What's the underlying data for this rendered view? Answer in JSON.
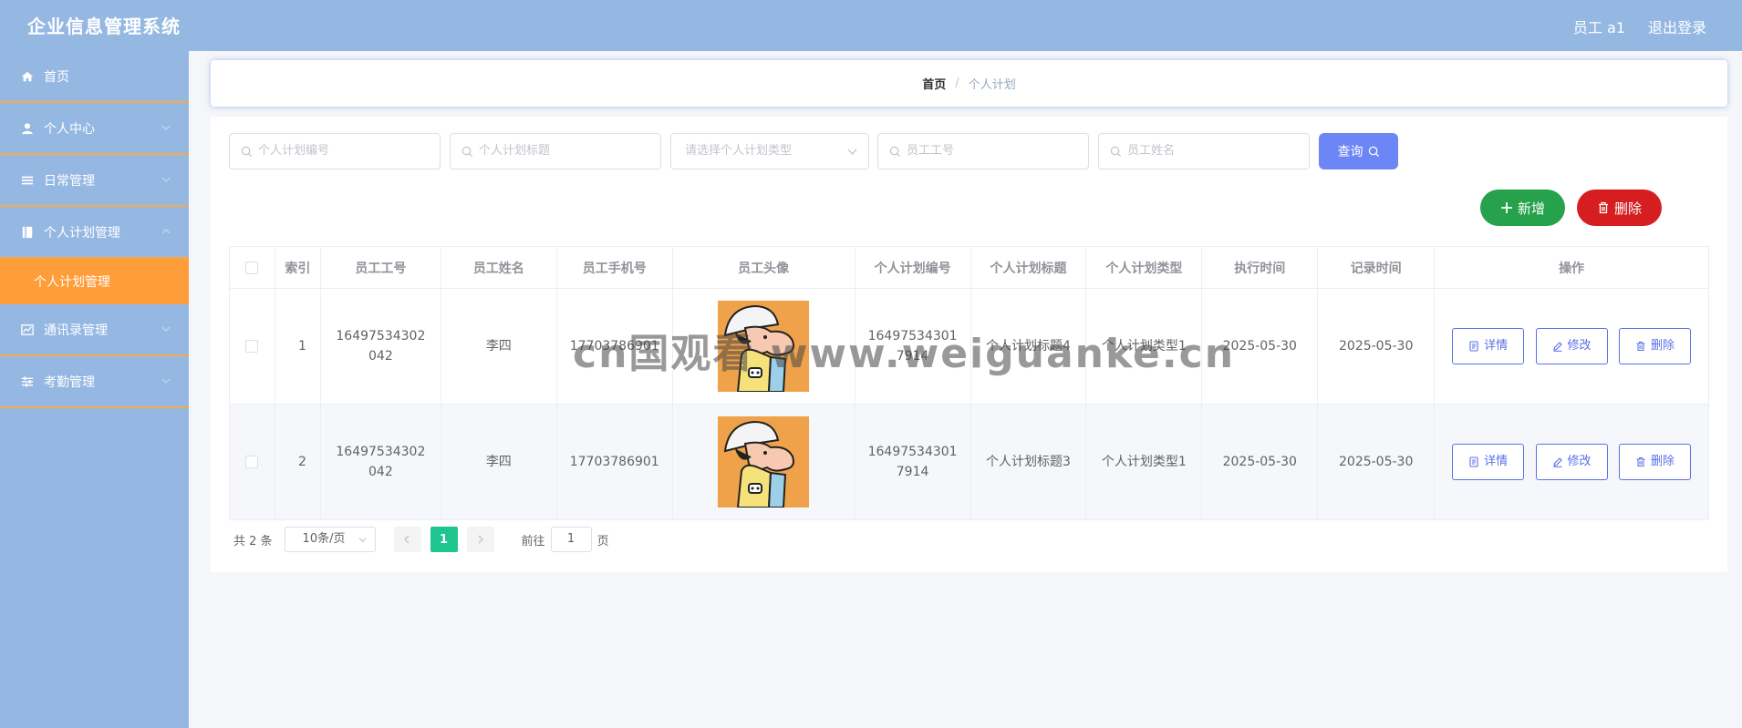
{
  "header": {
    "title": "企业信息管理系统",
    "user": "员工 a1",
    "logout": "退出登录"
  },
  "sidebar": {
    "items": [
      {
        "label": "首页",
        "icon": "home-icon"
      },
      {
        "label": "个人中心",
        "icon": "user-icon"
      },
      {
        "label": "日常管理",
        "icon": "list-icon"
      },
      {
        "label": "个人计划管理",
        "icon": "book-icon",
        "expanded": true,
        "sub": [
          {
            "label": "个人计划管理",
            "active": true
          }
        ]
      },
      {
        "label": "通讯录管理",
        "icon": "chart-icon"
      },
      {
        "label": "考勤管理",
        "icon": "sliders-icon"
      }
    ],
    "colors": {
      "background": "#95b8e3",
      "active": "#ff9d3a",
      "divider": "#f5a94b"
    }
  },
  "breadcrumb": {
    "home": "首页",
    "sep": "/",
    "current": "个人计划"
  },
  "search": {
    "plan_no_placeholder": "个人计划编号",
    "plan_title_placeholder": "个人计划标题",
    "plan_type_placeholder": "请选择个人计划类型",
    "emp_no_placeholder": "员工工号",
    "emp_name_placeholder": "员工姓名",
    "query_label": "查询"
  },
  "actions": {
    "add_label": "新增",
    "delete_label": "删除"
  },
  "table": {
    "columns": [
      "索引",
      "员工工号",
      "员工姓名",
      "员工手机号",
      "员工头像",
      "个人计划编号",
      "个人计划标题",
      "个人计划类型",
      "执行时间",
      "记录时间",
      "操作"
    ],
    "rows": [
      {
        "index": "1",
        "emp_no": "16497534302042",
        "emp_name": "李四",
        "phone": "17703786901",
        "plan_no": "164975343017914",
        "plan_title": "个人计划标题4",
        "plan_type": "个人计划类型1",
        "exec_time": "2025-05-30",
        "record_time": "2025-05-30"
      },
      {
        "index": "2",
        "emp_no": "16497534302042",
        "emp_name": "李四",
        "phone": "17703786901",
        "plan_no": "164975343017914",
        "plan_title": "个人计划标题3",
        "plan_type": "个人计划类型1",
        "exec_time": "2025-05-30",
        "record_time": "2025-05-30"
      }
    ],
    "ops": {
      "detail": "详情",
      "edit": "修改",
      "delete": "删除"
    }
  },
  "pagination": {
    "total": "共 2 条",
    "page_size": "10条/页",
    "current_page": "1",
    "goto_prefix": "前往",
    "goto_value": "1",
    "goto_suffix": "页"
  },
  "watermark": "cn国观看 www.weiguanke.cn",
  "colors": {
    "accent": "#6d86f6",
    "success": "#25a24b",
    "danger": "#d61e20",
    "pager_active": "#1ec58e"
  }
}
